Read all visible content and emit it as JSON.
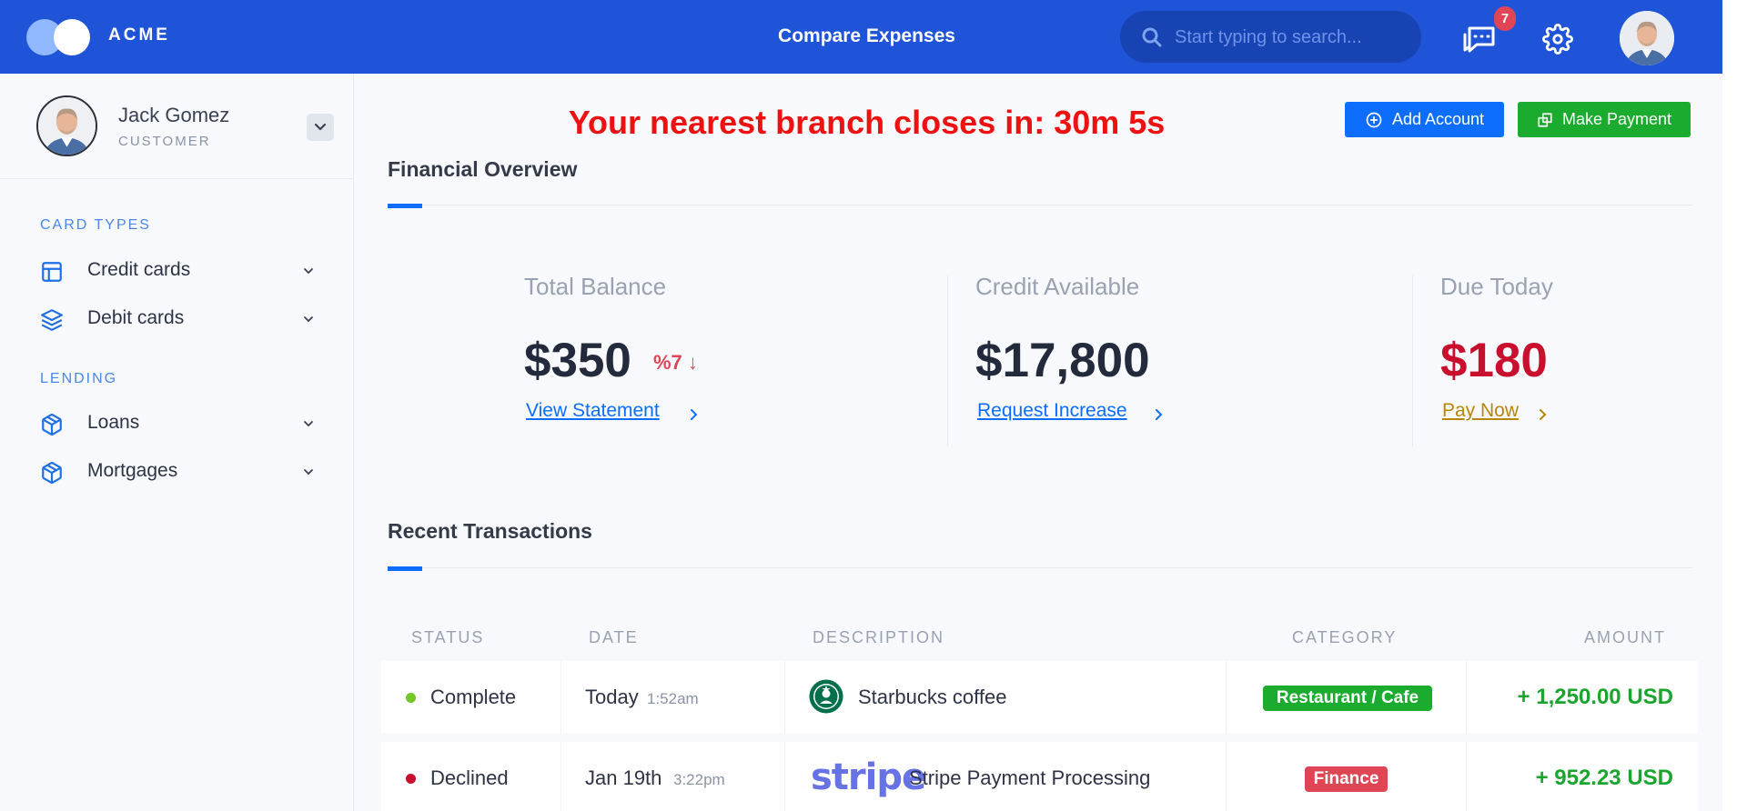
{
  "app": {
    "brand": "ACME",
    "title": "Compare Expenses",
    "search_placeholder": "Start typing to search...",
    "notifications_count": "7"
  },
  "user": {
    "name": "Jack Gomez",
    "role": "CUSTOMER"
  },
  "sidebar": {
    "sections": [
      {
        "heading": "CARD TYPES",
        "items": [
          {
            "label": "Credit cards",
            "icon": "layout-icon"
          },
          {
            "label": "Debit cards",
            "icon": "layers-icon"
          }
        ]
      },
      {
        "heading": "LENDING",
        "items": [
          {
            "label": "Loans",
            "icon": "package-icon"
          },
          {
            "label": "Mortgages",
            "icon": "package-icon"
          }
        ]
      }
    ]
  },
  "banner": "Your nearest branch closes in: 30m 5s",
  "actions": {
    "add_account": "Add Account",
    "make_payment": "Make Payment"
  },
  "overview": {
    "heading": "Financial Overview",
    "stats": [
      {
        "label": "Total Balance",
        "value": "$350",
        "delta": "%7 ↓",
        "link": "View Statement"
      },
      {
        "label": "Credit Available",
        "value": "$17,800",
        "link": "Request Increase"
      },
      {
        "label": "Due Today",
        "value": "$180",
        "link": "Pay Now"
      }
    ]
  },
  "transactions": {
    "heading": "Recent Transactions",
    "columns": [
      "STATUS",
      "DATE",
      "DESCRIPTION",
      "CATEGORY",
      "AMOUNT"
    ],
    "rows": [
      {
        "status": "Complete",
        "status_color": "#73c528",
        "date": "Today",
        "time": "1:52am",
        "logo": "starbucks-logo",
        "description": "Starbucks coffee",
        "category": "Restaurant / Cafe",
        "category_color": "#1bab2e",
        "amount": "+ 1,250.00 USD"
      },
      {
        "status": "Declined",
        "status_color": "#c8102e",
        "date": "Jan 19th",
        "time": "3:22pm",
        "logo": "stripe-logo",
        "logo_text": "stripe",
        "description": "Stripe Payment Processing",
        "category": "Finance",
        "category_color": "#e04556",
        "amount": "+ 952.23 USD"
      }
    ]
  },
  "colors": {
    "topbar": "#1f54d9",
    "primary": "#0d6efd",
    "success": "#1bab2e",
    "danger_text": "#ee1111",
    "due_value": "#c8102e",
    "pay_link": "#b8860b"
  }
}
